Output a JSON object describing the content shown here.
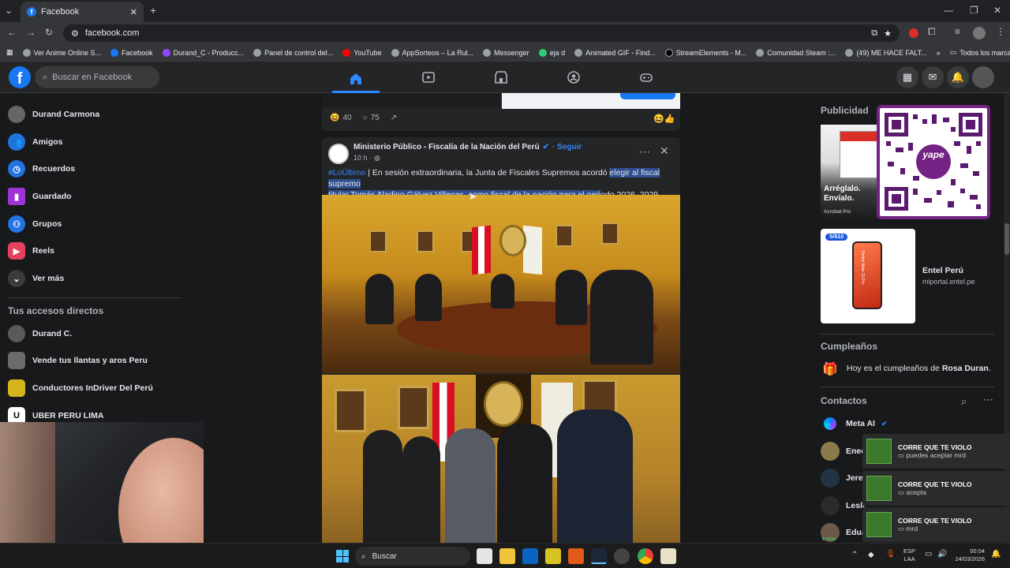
{
  "browser": {
    "tab_title": "Facebook",
    "url": "facebook.com",
    "bookmarks": [
      "Ver Anime Online S...",
      "Facebook",
      "Durand_C - Producc...",
      "Panel de control del...",
      "YouTube",
      "AppSorteos – La Rul...",
      "Messenger",
      "eja d",
      "Animated GIF - Find...",
      "StreamElements - M...",
      "Comunidad Steam :...",
      "(49) ME HACE FALT..."
    ],
    "all_bookmarks": "Todos los marcadores"
  },
  "fb": {
    "search_placeholder": "Buscar en Facebook",
    "sidebar": [
      {
        "label": "Durand Carmona",
        "icon": "avatar"
      },
      {
        "label": "Amigos",
        "icon": "friends-icon"
      },
      {
        "label": "Recuerdos",
        "icon": "memories-icon"
      },
      {
        "label": "Guardado",
        "icon": "bookmark-icon"
      },
      {
        "label": "Grupos",
        "icon": "groups-icon"
      },
      {
        "label": "Reels",
        "icon": "reels-icon"
      },
      {
        "label": "Ver más",
        "icon": "chevron-down-icon"
      }
    ],
    "shortcuts_title": "Tus accesos directos",
    "shortcuts": [
      "Durand C.",
      "Vende tus llantas y aros Peru",
      "Conductores InDriver Del Perú",
      "UBER PERU LIMA"
    ],
    "prev_post": {
      "reactions": "40",
      "comments": "75"
    },
    "post": {
      "author": "Ministerio Público - Fiscalía de la Nación del Perú",
      "follow": "· Seguir",
      "time": "10 h ·",
      "hashtag": "#LoÚltimo",
      "text_plain": " | En sesión extraordinaria, la Junta de Fiscales Supremos acordó ",
      "text_sel1": "elegir al fiscal supremo",
      "text_sel2": "titular Tomás Aladino Gálvez Villegas, como fiscal de la nación para el peri",
      "text_end": "odo 2026–2029."
    },
    "ads_title": "Publicidad",
    "ad1": {
      "headline": "Arréglalo. Envíalo.",
      "brand": "Acrobat Pro",
      "qr_brand": "yape"
    },
    "ad2": {
      "name": "Entel Perú",
      "url": "miportal.entel.pe",
      "badge": "S/610",
      "phone": "Redmi Note 13 Pro"
    },
    "birthdays_title": "Cumpleaños",
    "birthday_pre": "Hoy es el cumpleaños de ",
    "birthday_name": "Rosa Duran",
    "birthday_post": ".",
    "contacts_title": "Contactos",
    "contacts": [
      "Meta AI",
      "Enec",
      "Jere",
      "Lesli",
      "Edua"
    ],
    "contact_time": "6 min"
  },
  "notifications": [
    {
      "title": "CORRE QUE TE VIOLO",
      "text": "puedes aceptar mrd"
    },
    {
      "title": "CORRE QUE TE VIOLO",
      "text": "acepta"
    },
    {
      "title": "CORRE QUE TE VIOLO",
      "text": "mrd"
    }
  ],
  "taskbar": {
    "search": "Buscar",
    "lang1": "ESP",
    "lang2": "LAA",
    "time": "00:04",
    "date": "24/03/2026"
  }
}
